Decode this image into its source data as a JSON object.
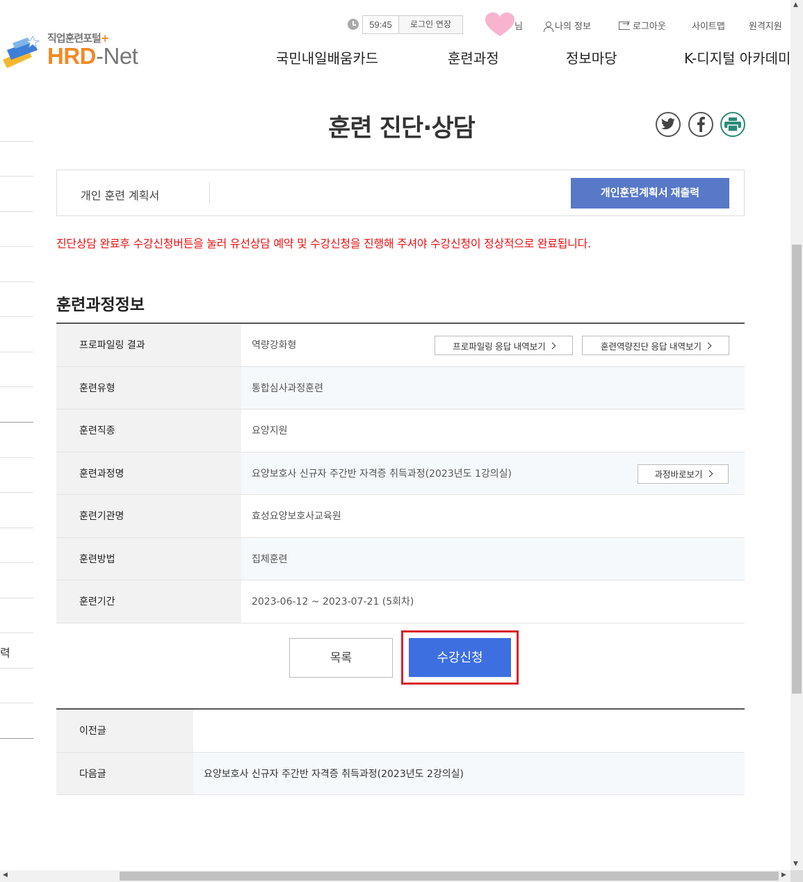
{
  "header": {
    "logo_sub": "직업훈련포털",
    "logo_plus": "+",
    "logo_hrd": "HRD",
    "logo_dash": "-",
    "logo_net": "Net",
    "timer": "59:45",
    "extend_login": "로그인 연장",
    "user_suffix": "님",
    "my_info": "나의 정보",
    "logout": "로그아웃",
    "sitemap": "사이트맵",
    "remote_support": "원격지원"
  },
  "gnb": [
    "국민내일배움카드",
    "훈련과정",
    "정보마당",
    "K-디지털 아카데미"
  ],
  "sidebar_partial_text": "력",
  "page": {
    "title": "훈련 진단·상담",
    "plan_label": "개인 훈련 계획서",
    "plan_reprint_button": "개인훈련계획서 재출력",
    "notice": "진단상담 완료후 수강신청버튼을 눌러 유선상담 예약 및 수강신청을 진행해 주셔야 수강신청이 정상적으로 완료됩니다.",
    "section_title": "훈련과정정보"
  },
  "info_rows": [
    {
      "label": "프로파일링 결과",
      "value": "역량강화형"
    },
    {
      "label": "훈련유형",
      "value": "통합심사과정훈련"
    },
    {
      "label": "훈련직종",
      "value": "요양지원"
    },
    {
      "label": "훈련과정명",
      "value": "요양보호사 신규자 주간반 자격증 취득과정(2023년도 1강의실)"
    },
    {
      "label": "훈련기관명",
      "value": "효성요양보호사교육원"
    },
    {
      "label": "훈련방법",
      "value": "집체훈련"
    },
    {
      "label": "훈련기간",
      "value": "2023-06-12 ~ 2023-07-21 (5회차)"
    }
  ],
  "info_buttons": {
    "profiling_history": "프로파일링 응답 내역보기",
    "competency_history": "훈련역량진단 응답 내역보기",
    "course_shortcut": "과정바로보기"
  },
  "actions": {
    "list": "목록",
    "apply": "수강신청"
  },
  "prev_next": [
    {
      "label": "이전글",
      "value": ""
    },
    {
      "label": "다음글",
      "value": "요양보호사 신규자 주간반 자격증 취득과정(2023년도 2강의실)"
    }
  ],
  "colors": {
    "brand_orange": "#f08a24",
    "primary_blue": "#3e6fe0",
    "plan_button": "#5878c8",
    "notice_red": "#e11111",
    "highlight_red": "#d9202a",
    "heart_pink": "#f8b4cf"
  }
}
